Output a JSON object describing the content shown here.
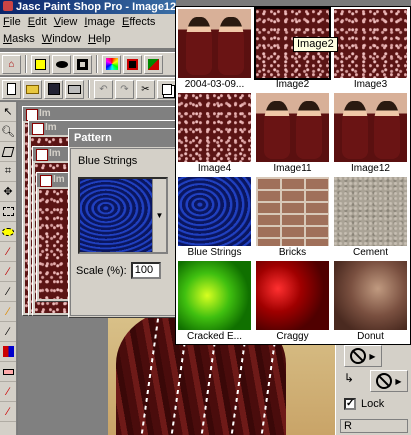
{
  "app": {
    "title": "Jasc Paint Shop Pro - Image12"
  },
  "menus": {
    "row1": [
      {
        "key": "F",
        "rest": "ile"
      },
      {
        "key": "E",
        "rest": "dit"
      },
      {
        "key": "V",
        "rest": "iew"
      },
      {
        "key": "I",
        "rest": "mage"
      },
      {
        "key": "E",
        "rest": "ffects"
      }
    ],
    "row2": [
      {
        "key": "M",
        "rest": "asks"
      },
      {
        "key": "W",
        "rest": "indow"
      },
      {
        "key": "H",
        "rest": "elp"
      }
    ]
  },
  "workspace": {
    "doc_titles": [
      "Im",
      "Im",
      "Im",
      "Im"
    ]
  },
  "pattern_dialog": {
    "title": "Pattern",
    "pattern_name": "Blue Strings",
    "scale_label": "Scale (%):",
    "scale_value": "100"
  },
  "picker": {
    "tooltip": "Image2",
    "items": [
      {
        "label": "2004-03-09...",
        "kind": "ladies"
      },
      {
        "label": "Image2",
        "kind": "sparkle"
      },
      {
        "label": "Image3",
        "kind": "sparkle"
      },
      {
        "label": "Image4",
        "kind": "sparkle"
      },
      {
        "label": "Image11",
        "kind": "ladies"
      },
      {
        "label": "Image12",
        "kind": "ladies"
      },
      {
        "label": "Blue Strings",
        "kind": "blue"
      },
      {
        "label": "Bricks",
        "kind": "bricks"
      },
      {
        "label": "Cement",
        "kind": "cement"
      },
      {
        "label": "Cracked E...",
        "kind": "cracked"
      },
      {
        "label": "Craggy",
        "kind": "craggy"
      },
      {
        "label": "Donut",
        "kind": "donut"
      }
    ]
  },
  "right_panel": {
    "lock_label": "Lock",
    "lock_checked": "✓",
    "field_text": "R"
  },
  "colors": {
    "title_bar": "#0a246a",
    "face": "#d4d0c8",
    "tooltip_bg": "#ffffe1"
  },
  "icons": {
    "toolbar": [
      "new-icon",
      "folder-open-icon",
      "save-icon",
      "print-icon",
      "undo-icon",
      "redo-icon",
      "cut-icon",
      "copy-icon",
      "paste-icon"
    ],
    "tools": [
      "arrow-icon",
      "zoom-icon",
      "deform-icon",
      "crop-icon",
      "move-icon",
      "selection-icon",
      "freehand-icon",
      "dropper-icon",
      "paint-brush-icon",
      "clone-brush-icon",
      "color-replacer-icon",
      "retouch-icon",
      "scratch-remover-icon",
      "eraser-icon",
      "picture-tube-icon",
      "airbrush-icon"
    ]
  }
}
